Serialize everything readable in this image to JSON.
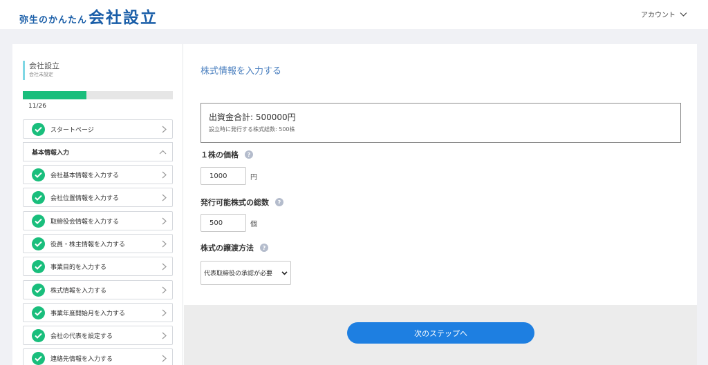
{
  "header": {
    "logo_small": "弥生のかんたん",
    "logo_big": "会社設立",
    "account_label": "アカウント"
  },
  "sidebar": {
    "company_name": "会社設立",
    "company_status": "会社未設定",
    "progress": {
      "current": 11,
      "total": 26,
      "label": "11/26"
    },
    "start_item": "スタートページ",
    "section_title": "基本情報入力",
    "items": [
      {
        "label": "会社基本情報を入力する"
      },
      {
        "label": "会社位置情報を入力する"
      },
      {
        "label": "取締役会情報を入力する"
      },
      {
        "label": "役員・株主情報を入力する"
      },
      {
        "label": "事業目的を入力する"
      },
      {
        "label": "株式情報を入力する"
      },
      {
        "label": "事業年度開始月を入力する"
      },
      {
        "label": "会社の代表を設定する"
      },
      {
        "label": "連絡先情報を入力する"
      }
    ]
  },
  "main": {
    "title": "株式情報を入力する",
    "summary_total": "出資金合計: 500000円",
    "summary_sub": "設立時に発行する株式総数: 500株",
    "price_label": "１株の価格",
    "price_value": "1000",
    "price_unit": "円",
    "authorized_label": "発行可能株式の総数",
    "authorized_value": "500",
    "authorized_unit": "個",
    "transfer_label": "株式の譲渡方法",
    "transfer_value": "代表取締役の承認が必要",
    "help_glyph": "?",
    "next_button": "次のステップへ"
  },
  "colors": {
    "accent_blue": "#1e7fe1",
    "logo_blue": "#1a5ea8",
    "check_green": "#19be7c",
    "title_blue": "#4a7fbf"
  }
}
